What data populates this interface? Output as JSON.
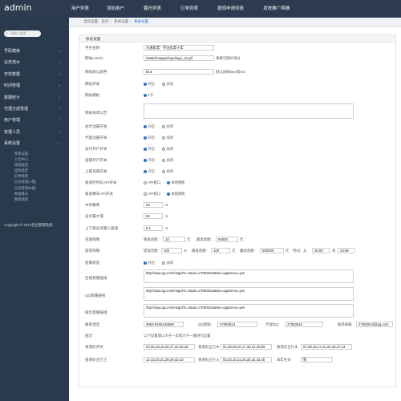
{
  "app": {
    "logo": "admin"
  },
  "topnav": [
    "用户列表",
    "添加用户",
    "委托列表",
    "订单列表",
    "提现申请列表",
    "发放推广明细"
  ],
  "sidebar": {
    "search_placeholder": "请输入搜索",
    "items": [
      "号码模板",
      "业务流水",
      "开奖数据",
      "时间管理",
      "数据统计",
      "代理分成管理",
      "用户管理",
      "管理人员",
      "系统设置"
    ],
    "subitems": [
      "系统设置",
      "公告中心",
      "收款类型",
      "提款类型",
      "彩种管理",
      "玩法管理(A盘)",
      "玩法管理(B盘)",
      "数据备份",
      "数据清理"
    ],
    "copyright": "Copyright © 2017后台管理系统"
  },
  "breadcrumb": {
    "home": "当前位置：首页",
    "parent": "系统设置",
    "current": "系统设置"
  },
  "panel_title": "系统设置",
  "fields": {
    "platform_name": {
      "label": "平台名称",
      "value": "大通彩票 - 专注彩票十年"
    },
    "site_logo": {
      "label": "网站LOGO",
      "value": "/static/images/logo/logo_22.gif",
      "note": "请填写图片地址"
    },
    "default_color": {
      "label": "网站默认颜色",
      "value": "blue",
      "note": "默认皮肤blue或red"
    },
    "site_switch": {
      "label": "网站开关",
      "on": "开启",
      "off": "关闭"
    },
    "site_template": {
      "label": "网站模板",
      "value": "1号"
    },
    "close_notice": {
      "label": "网站关闭公告"
    },
    "agent_master": {
      "label": "总代注册开关",
      "on": "开启",
      "off": "关闭"
    },
    "agent_reg": {
      "label": "代理注册开关",
      "on": "开启",
      "off": "关闭"
    },
    "agent_open": {
      "label": "总代开户开关",
      "on": "开启",
      "off": "关闭"
    },
    "lower_open": {
      "label": "层级开户开关",
      "on": "开启",
      "off": "关闭"
    },
    "upper_recharge": {
      "label": "上级充值开关",
      "on": "开启",
      "off": "关闭"
    },
    "abort_api": {
      "label": "极速时时彩API开关",
      "api": "API接口",
      "local": "本地随机"
    },
    "fast_api": {
      "label": "极速赛车API开关",
      "api": "API接口",
      "local": "本地随机"
    },
    "win_rate": {
      "label": "中奖概率",
      "value": "20",
      "unit": "%"
    },
    "return_rate": {
      "label": "返点最大值",
      "value": "50",
      "unit": "%"
    },
    "step_diff": {
      "label": "上下级返点最小差值",
      "value": "0.1",
      "unit": "%"
    },
    "recharge_limit": {
      "label": "充值限制",
      "min_label": "最低金额：",
      "min": "10",
      "mid": "元",
      "max_label": "最高金额：",
      "max": "50000",
      "unit": "元"
    },
    "withdraw_limit": {
      "label": "提现限制",
      "count_label": "提现次数：",
      "count": "100",
      "unit1": "%",
      "min_label": "最低金额：",
      "min": "100",
      "unit2": "元",
      "max_label": "最高金额：",
      "max": "500000",
      "unit3": "元",
      "time_label": "时间：从",
      "from": "00:00",
      "to_label": "到",
      "to": "23:59"
    },
    "kefu_status": {
      "label": "客服状态",
      "on": "开启",
      "off": "关闭"
    },
    "online_kefu": {
      "label": "在线客服链接",
      "value": "http://wpa.qq.com/msgrd?v=3&uin=27083513&site=qq&menu=yes"
    },
    "qq_kefu": {
      "label": "QQ客服链接",
      "value": "http://wpa.qq.com/msgrd?v=3&uin=27083513&site=qq&menu=yes"
    },
    "wechat_kefu": {
      "label": "微信客服链接",
      "value": "http://wpa.qq.com/msgrd?v=3&uin=27083513&site=qq&menu=yes"
    },
    "contact": {
      "label": "联系电话",
      "phone": "0863-6165316588",
      "qq_label": "QQ客服：",
      "qq": "27083513",
      "agent_qq_label": "代理QQ：",
      "agent_qq": "27083513",
      "email_label": "联系邮箱",
      "email": "27083513@qq.com"
    },
    "tip": {
      "label": "提示",
      "value": "以下设置请以大于一年或大于一期进行设置"
    },
    "pk10_open": {
      "label": "香港彩开奖",
      "value": "04,08,18,19,26,27,34,35,46",
      "b_label": "香港彩五行木",
      "b_value": "01,06,09,16,17,30,31,38,39",
      "c_label": "香港彩五行水",
      "c_value": "07,08,16,17,22,23,36,37,44"
    },
    "pk10_close": {
      "label": "香港彩五行土",
      "value": "12,13,20,21,28,29,42,43",
      "b_label": "香港彩五行火",
      "b_value": "02,03,10,11,24,25,32,33,40",
      "c_label": "本年生肖",
      "c_value": "狗"
    }
  }
}
